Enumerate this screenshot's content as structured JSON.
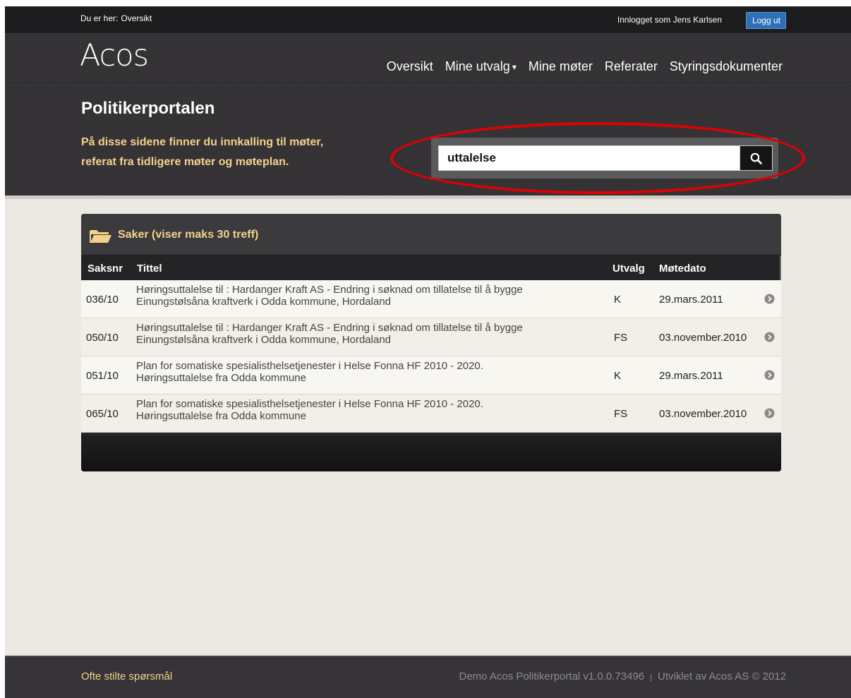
{
  "topbar": {
    "breadcrumb_label": "Du er her:",
    "breadcrumb_current": "Oversikt",
    "logged_in_text": "Innlogget som Jens Karlsen",
    "logout_label": "Logg ut"
  },
  "header": {
    "logo": "Acos",
    "nav": [
      {
        "label": "Oversikt"
      },
      {
        "label": "Mine utvalg"
      },
      {
        "label": "Mine møter"
      },
      {
        "label": "Referater"
      },
      {
        "label": "Styringsdokumenter"
      }
    ],
    "caret": "▾",
    "title": "Politikerportalen",
    "intro_line1": "På disse sidene finner du innkalling til møter,",
    "intro_line2": "referat fra tidligere møter og møteplan."
  },
  "search": {
    "value": "uttalelse",
    "icon": "search-icon",
    "highlight_color": "#e00000"
  },
  "results": {
    "title": "Saker (viser maks 30 treff)",
    "columns": {
      "saksnr": "Saksnr",
      "tittel": "Tittel",
      "utvalg": "Utvalg",
      "dato": "Møtedato"
    },
    "rows": [
      {
        "saksnr": "036/10",
        "title_line1": "Høringsuttalelse til : Hardanger Kraft AS - Endring i søknad om tillatelse til å bygge",
        "title_line2": "Einungstølsåna kraftverk i Odda kommune, Hordaland",
        "utvalg": "K",
        "dato": "29.mars.2011"
      },
      {
        "saksnr": "050/10",
        "title_line1": "Høringsuttalelse til : Hardanger Kraft AS - Endring i søknad om tillatelse til å bygge",
        "title_line2": "Einungstølsåna kraftverk i Odda kommune, Hordaland",
        "utvalg": "FS",
        "dato": "03.november.2010"
      },
      {
        "saksnr": "051/10",
        "title_line1": "Plan for somatiske spesialisthelsetjenester i Helse Fonna HF 2010 - 2020.",
        "title_line2": "Høringsuttalelse fra Odda kommune",
        "utvalg": "K",
        "dato": "29.mars.2011"
      },
      {
        "saksnr": "065/10",
        "title_line1": "Plan for somatiske spesialisthelsetjenester i Helse Fonna HF 2010 - 2020.",
        "title_line2": "Høringsuttalelse fra Odda kommune",
        "utvalg": "FS",
        "dato": "03.november.2010"
      }
    ]
  },
  "footer": {
    "faq_label": "Ofte stilte spørsmål",
    "version_text": "Demo Acos Politikerportal v1.0.0.73496",
    "separator": "|",
    "developer_text": "Utviklet av Acos AS © 2012"
  },
  "colors": {
    "accent_yellow": "#f4d28c",
    "header_bg": "#343235",
    "logout_blue": "#2f6fb6"
  }
}
